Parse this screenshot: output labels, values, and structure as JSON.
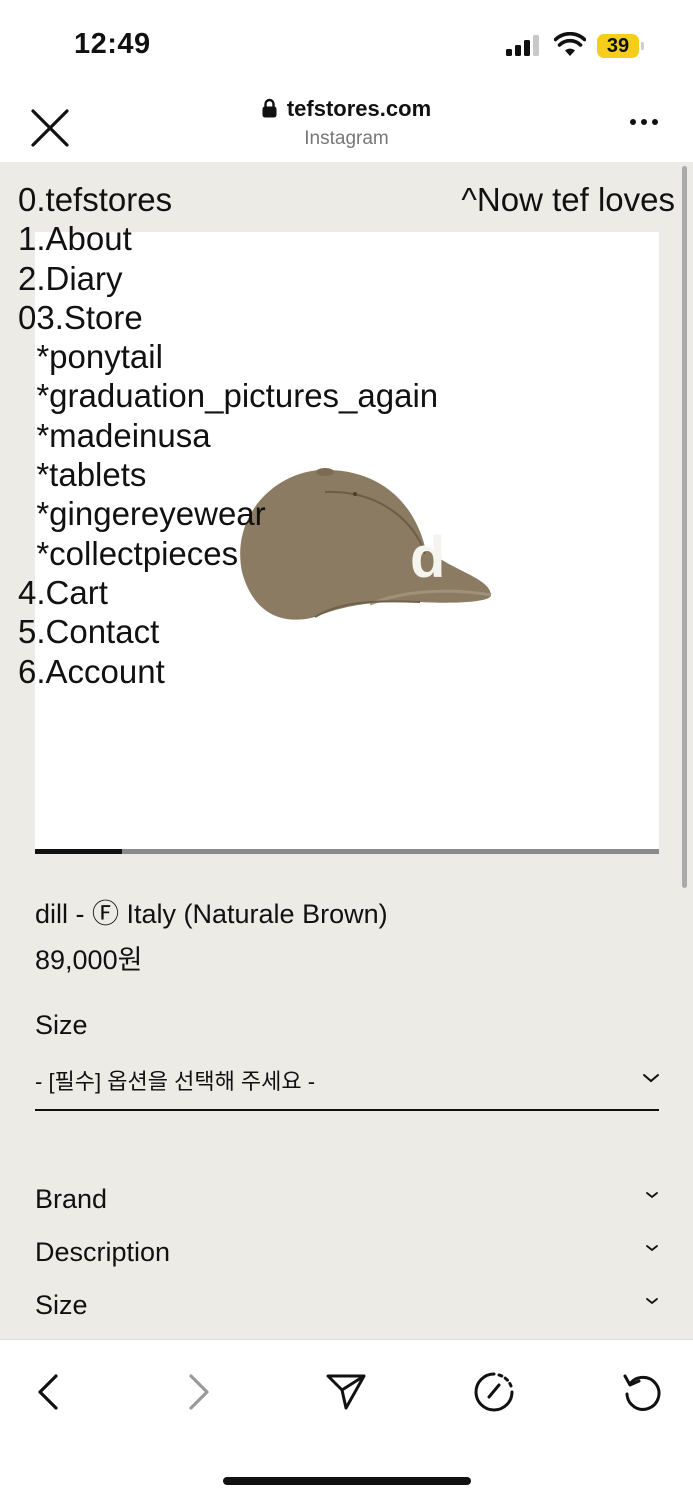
{
  "status": {
    "time": "12:49",
    "battery": "39"
  },
  "browser": {
    "url": "tefstores.com",
    "subtitle": "Instagram"
  },
  "nav": {
    "items": [
      "0.tefstores",
      "1.About",
      "2.Diary",
      "03.Store",
      "  *ponytail",
      "  *graduation_pictures_again",
      "  *madeinusa",
      "  *tablets",
      "  *gingereyewear",
      "  *collectpieces",
      "4.Cart",
      "5.Contact",
      "6.Account"
    ],
    "right_link": "^Now tef loves"
  },
  "product": {
    "logo_letter": "d",
    "name": "dill - Ⓕ Italy (Naturale Brown)",
    "price": "89,000원",
    "image_progress": 0.14,
    "size_label": "Size",
    "size_select": "- [필수] 옵션을 선택해 주세요 -"
  },
  "accordion": [
    "Brand",
    "Description",
    "Size"
  ],
  "icons": {
    "close": "close-icon",
    "lock": "lock-icon",
    "more": "more-icon",
    "back": "back-icon",
    "forward": "forward-icon",
    "share": "share-icon",
    "speed": "speed-icon",
    "reload": "reload-icon"
  }
}
